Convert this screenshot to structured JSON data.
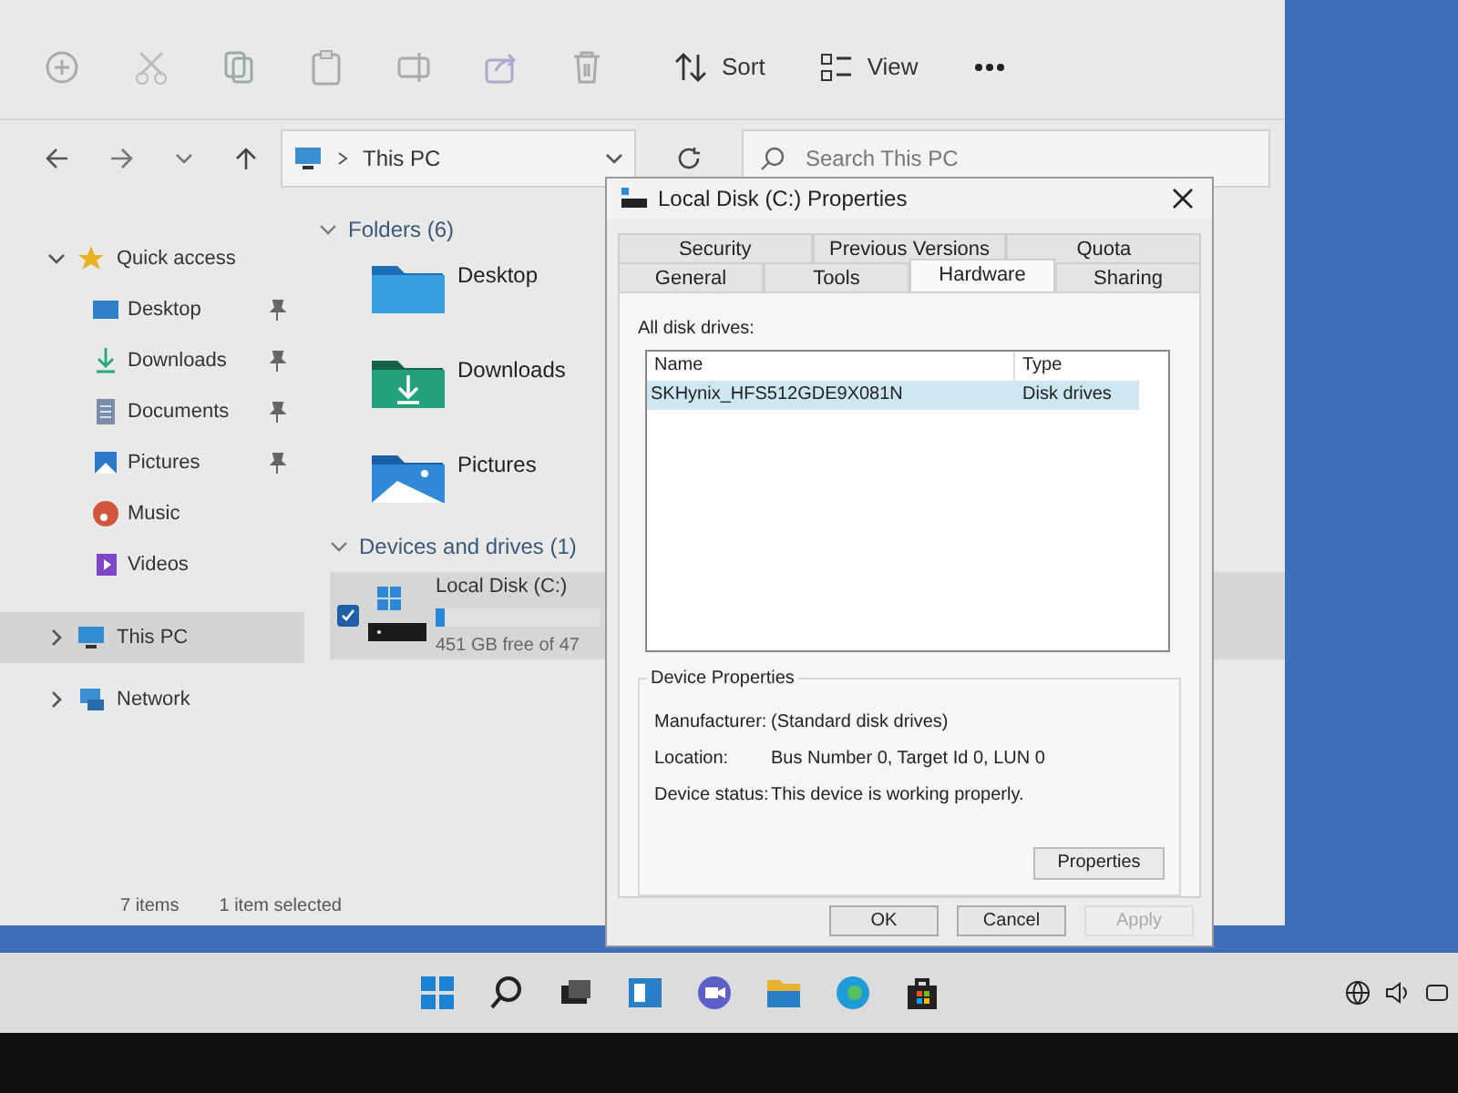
{
  "explorer": {
    "toolbar": {
      "sort": "Sort",
      "view": "View"
    },
    "address": {
      "path": "This PC",
      "search_placeholder": "Search This PC"
    },
    "sidebar": {
      "items": [
        {
          "label": "Quick access",
          "expanded": true,
          "selected": false,
          "children": [
            {
              "label": "Desktop",
              "pinned": true
            },
            {
              "label": "Downloads",
              "pinned": true
            },
            {
              "label": "Documents",
              "pinned": true
            },
            {
              "label": "Pictures",
              "pinned": true
            },
            {
              "label": "Music",
              "pinned": false
            },
            {
              "label": "Videos",
              "pinned": false
            }
          ]
        },
        {
          "label": "This PC",
          "expanded": false,
          "selected": true
        },
        {
          "label": "Network",
          "expanded": false,
          "selected": false
        }
      ]
    },
    "folders": {
      "heading": "Folders (6)",
      "items": [
        "Desktop",
        "Downloads",
        "Pictures"
      ]
    },
    "drives": {
      "heading": "Devices and drives (1)",
      "items": [
        {
          "name": "Local Disk (C:)",
          "level": 0.05,
          "free": "451 GB free of 47",
          "checked": true,
          "selected": true
        }
      ]
    },
    "status_bar": {
      "items": "7 items",
      "selection": "1 item selected"
    }
  },
  "dialog": {
    "title": "Local Disk (C:) Properties",
    "tab_rows": [
      [
        {
          "label": "Security",
          "selected": false
        },
        {
          "label": "Previous Versions",
          "selected": false
        },
        {
          "label": "Quota",
          "selected": false
        }
      ],
      [
        {
          "label": "General",
          "selected": false
        },
        {
          "label": "Tools",
          "selected": false
        },
        {
          "label": "Hardware",
          "selected": true
        },
        {
          "label": "Sharing",
          "selected": false
        }
      ]
    ],
    "list_label": "All disk drives:",
    "table": {
      "columns": [
        "Name",
        "Type"
      ],
      "rows": [
        {
          "cells": [
            "SKHynix_HFS512GDE9X081N",
            "Disk drives"
          ],
          "selected": true
        }
      ]
    },
    "group": {
      "title": "Device Properties",
      "fields": [
        {
          "label": "Manufacturer:",
          "value": "(Standard disk drives)"
        },
        {
          "label": "Location:",
          "value": "Bus Number 0, Target Id 0, LUN 0"
        },
        {
          "label": "Device status:",
          "value": "This device is working properly."
        }
      ],
      "button": "Properties"
    },
    "buttons": [
      {
        "label": "OK",
        "disabled": false
      },
      {
        "label": "Cancel",
        "disabled": false
      },
      {
        "label": "Apply",
        "disabled": true
      }
    ]
  }
}
